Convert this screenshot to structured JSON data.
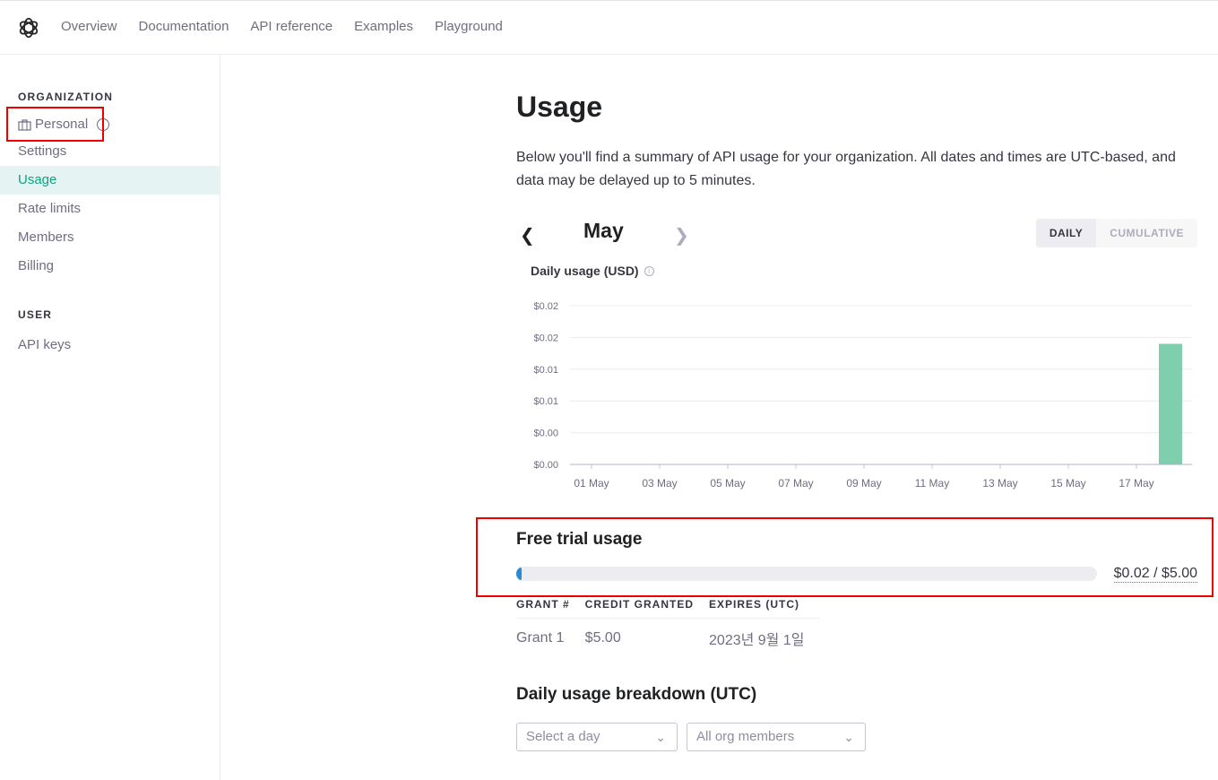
{
  "nav": {
    "links": [
      "Overview",
      "Documentation",
      "API reference",
      "Examples",
      "Playground"
    ]
  },
  "sidebar": {
    "org_heading": "ORGANIZATION",
    "personal": "Personal",
    "items": [
      "Settings",
      "Usage",
      "Rate limits",
      "Members",
      "Billing"
    ],
    "user_heading": "USER",
    "api_keys": "API keys",
    "active_item": "Usage"
  },
  "main": {
    "title": "Usage",
    "description": "Below you'll find a summary of API usage for your organization. All dates and times are UTC-based, and data may be delayed up to 5 minutes.",
    "month": "May",
    "toggle_daily": "DAILY",
    "toggle_cumulative": "CUMULATIVE",
    "chart_title": "Daily usage (USD)"
  },
  "chart_data": {
    "type": "bar",
    "title": "Daily usage (USD)",
    "y_tick_labels": [
      "$0.02",
      "$0.02",
      "$0.01",
      "$0.01",
      "$0.00",
      "$0.00"
    ],
    "x_tick_labels": [
      "01 May",
      "03 May",
      "05 May",
      "07 May",
      "09 May",
      "11 May",
      "13 May",
      "15 May",
      "17 May"
    ],
    "categories": [
      "01 May",
      "02 May",
      "03 May",
      "04 May",
      "05 May",
      "06 May",
      "07 May",
      "08 May",
      "09 May",
      "10 May",
      "11 May",
      "12 May",
      "13 May",
      "14 May",
      "15 May",
      "16 May",
      "17 May",
      "18 May"
    ],
    "values": [
      0,
      0,
      0,
      0,
      0,
      0,
      0,
      0,
      0,
      0,
      0,
      0,
      0,
      0,
      0,
      0,
      0,
      0.019
    ],
    "ylim": [
      0,
      0.025
    ],
    "bar_color": "#7fcfae",
    "grid": true
  },
  "free_trial": {
    "title": "Free trial usage",
    "amount": "$0.02 / $5.00",
    "used_fraction": 0.004,
    "bar_color": "#2a8bd1"
  },
  "grants": {
    "headers": [
      "GRANT #",
      "CREDIT GRANTED",
      "EXPIRES (UTC)"
    ],
    "rows": [
      [
        "Grant 1",
        "$5.00",
        "2023년 9월 1일"
      ]
    ]
  },
  "breakdown": {
    "title": "Daily usage breakdown (UTC)",
    "day_select": "Select a day",
    "member_select": "All org members"
  }
}
